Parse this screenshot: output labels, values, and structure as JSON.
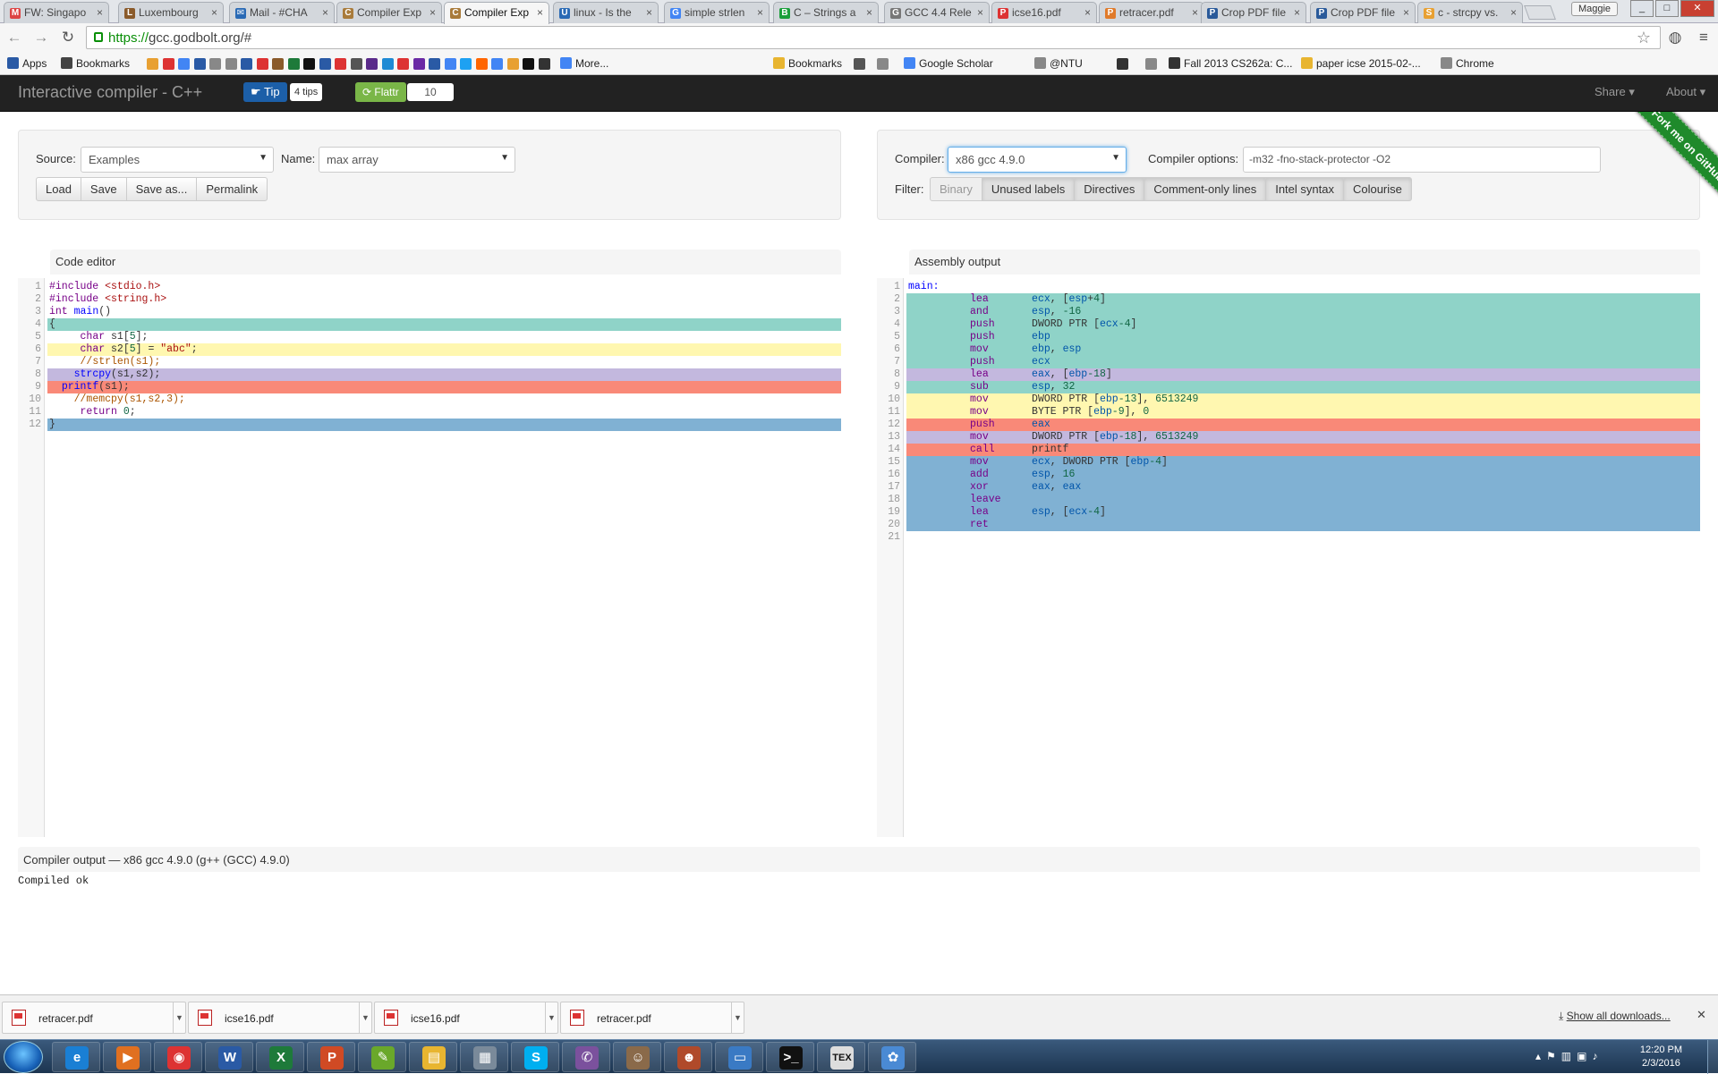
{
  "browser": {
    "tabs": [
      {
        "title": "FW: Singapo",
        "fav": "M",
        "color": "#d44"
      },
      {
        "title": "Luxembourg",
        "fav": "L",
        "color": "#8a5a2a"
      },
      {
        "title": "Mail - #CHA",
        "fav": "✉",
        "color": "#2a6ab5"
      },
      {
        "title": "Compiler Exp",
        "fav": "C",
        "color": "#a97b3a"
      },
      {
        "title": "Compiler Exp",
        "fav": "C",
        "color": "#a97b3a"
      },
      {
        "title": "linux - Is the",
        "fav": "U",
        "color": "#2a6ab5"
      },
      {
        "title": "simple strlen",
        "fav": "G",
        "color": "#4285f4"
      },
      {
        "title": "C – Strings a",
        "fav": "B",
        "color": "#1a9f3a"
      },
      {
        "title": "GCC 4.4 Rele",
        "fav": "G",
        "color": "#777"
      },
      {
        "title": "icse16.pdf",
        "fav": "P",
        "color": "#d33"
      },
      {
        "title": "retracer.pdf",
        "fav": "P",
        "color": "#e07a2a"
      },
      {
        "title": "Crop PDF file",
        "fav": "P",
        "color": "#2a5a9a"
      },
      {
        "title": "Crop PDF file",
        "fav": "P",
        "color": "#2a5a9a"
      },
      {
        "title": "c - strcpy vs.",
        "fav": "S",
        "color": "#e8a032"
      }
    ],
    "user": "Maggie",
    "window_buttons": [
      "_",
      "□",
      "✕"
    ],
    "url_scheme": "https://",
    "url_rest": "gcc.godbolt.org/#",
    "bookmarks": [
      {
        "label": "Apps",
        "icon": "#2a5aa5"
      },
      {
        "label": "Bookmarks",
        "icon": "#444"
      },
      {
        "label": "More...",
        "icon": "#4285f4"
      },
      {
        "label": "Bookmarks",
        "icon": "#e8b530"
      },
      {
        "label": "Google Scholar",
        "icon": "#4285f4"
      },
      {
        "label": "@NTU",
        "icon": "#888"
      },
      {
        "label": "Fall 2013 CS262a: C...",
        "icon": "#333"
      },
      {
        "label": "paper icse 2015-02-...",
        "icon": "#e8b530"
      },
      {
        "label": "Chrome",
        "icon": "#888"
      }
    ]
  },
  "navbar": {
    "brand": "Interactive compiler - C++",
    "tip_label": "Tip",
    "tip_count": "4 tips",
    "flattr_label": "Flattr",
    "flattr_count": "10",
    "share_label": "Share",
    "about_label": "About",
    "ribbon": "Fork me on GitHub"
  },
  "source": {
    "source_label": "Source:",
    "source_value": "Examples",
    "name_label": "Name:",
    "name_value": "max array",
    "buttons": [
      "Load",
      "Save",
      "Save as...",
      "Permalink"
    ]
  },
  "compiler": {
    "compiler_label": "Compiler:",
    "compiler_value": "x86 gcc 4.9.0",
    "options_label": "Compiler options:",
    "options_value": "-m32  -fno-stack-protector -O2",
    "filter_label": "Filter:",
    "filters": [
      "Binary",
      "Unused labels",
      "Directives",
      "Comment-only lines",
      "Intel syntax",
      "Colourise"
    ]
  },
  "editor": {
    "title": "Code editor",
    "lines": [
      {
        "n": "1",
        "text": "#include <stdio.h>",
        "bg": ""
      },
      {
        "n": "2",
        "text": "#include <string.h>",
        "bg": ""
      },
      {
        "n": "3",
        "text": "int main()",
        "bg": ""
      },
      {
        "n": "4",
        "text": "{",
        "bg": "#8fd3c8"
      },
      {
        "n": "5",
        "text": "     char s1[5];",
        "bg": ""
      },
      {
        "n": "6",
        "text": "     char s2[5] = \"abc\";",
        "bg": "#fff7b0"
      },
      {
        "n": "7",
        "text": "     //strlen(s1);",
        "bg": ""
      },
      {
        "n": "8",
        "text": "    strcpy(s1,s2);",
        "bg": "#c3b8de"
      },
      {
        "n": "9",
        "text": "  printf(s1);",
        "bg": "#f98978"
      },
      {
        "n": "10",
        "text": "    //memcpy(s1,s2,3);",
        "bg": ""
      },
      {
        "n": "11",
        "text": "     return 0;",
        "bg": ""
      },
      {
        "n": "12",
        "text": "}",
        "bg": "#80b1d3"
      }
    ]
  },
  "assembly": {
    "title": "Assembly output",
    "lines": [
      {
        "n": "1",
        "op": "",
        "args": "main:",
        "bg": ""
      },
      {
        "n": "2",
        "op": "lea",
        "args": "ecx, [esp+4]",
        "bg": "#8fd3c8"
      },
      {
        "n": "3",
        "op": "and",
        "args": "esp, -16",
        "bg": "#8fd3c8"
      },
      {
        "n": "4",
        "op": "push",
        "args": "DWORD PTR [ecx-4]",
        "bg": "#8fd3c8"
      },
      {
        "n": "5",
        "op": "push",
        "args": "ebp",
        "bg": "#8fd3c8"
      },
      {
        "n": "6",
        "op": "mov",
        "args": "ebp, esp",
        "bg": "#8fd3c8"
      },
      {
        "n": "7",
        "op": "push",
        "args": "ecx",
        "bg": "#8fd3c8"
      },
      {
        "n": "8",
        "op": "lea",
        "args": "eax, [ebp-18]",
        "bg": "#c3b8de"
      },
      {
        "n": "9",
        "op": "sub",
        "args": "esp, 32",
        "bg": "#8fd3c8"
      },
      {
        "n": "10",
        "op": "mov",
        "args": "DWORD PTR [ebp-13], 6513249",
        "bg": "#fff7b0"
      },
      {
        "n": "11",
        "op": "mov",
        "args": "BYTE PTR [ebp-9], 0",
        "bg": "#fff7b0"
      },
      {
        "n": "12",
        "op": "push",
        "args": "eax",
        "bg": "#f98978"
      },
      {
        "n": "13",
        "op": "mov",
        "args": "DWORD PTR [ebp-18], 6513249",
        "bg": "#c3b8de"
      },
      {
        "n": "14",
        "op": "call",
        "args": "printf",
        "bg": "#f98978"
      },
      {
        "n": "15",
        "op": "mov",
        "args": "ecx, DWORD PTR [ebp-4]",
        "bg": "#80b1d3"
      },
      {
        "n": "16",
        "op": "add",
        "args": "esp, 16",
        "bg": "#80b1d3"
      },
      {
        "n": "17",
        "op": "xor",
        "args": "eax, eax",
        "bg": "#80b1d3"
      },
      {
        "n": "18",
        "op": "leave",
        "args": "",
        "bg": "#80b1d3"
      },
      {
        "n": "19",
        "op": "lea",
        "args": "esp, [ecx-4]",
        "bg": "#80b1d3"
      },
      {
        "n": "20",
        "op": "ret",
        "args": "",
        "bg": "#80b1d3"
      },
      {
        "n": "21",
        "op": "",
        "args": "",
        "bg": ""
      }
    ]
  },
  "output": {
    "title": "Compiler output — x86 gcc 4.9.0 (g++ (GCC) 4.9.0)",
    "text": "Compiled ok"
  },
  "downloads": {
    "items": [
      "retracer.pdf",
      "icse16.pdf",
      "icse16.pdf",
      "retracer.pdf"
    ],
    "show_all": "Show all downloads..."
  },
  "taskbar": {
    "apps": [
      {
        "name": "ie",
        "glyph": "e",
        "color": "#1a7fd4"
      },
      {
        "name": "media",
        "glyph": "▶",
        "color": "#e07020"
      },
      {
        "name": "chrome",
        "glyph": "◉",
        "color": "#d33"
      },
      {
        "name": "word",
        "glyph": "W",
        "color": "#2a5aa5"
      },
      {
        "name": "excel",
        "glyph": "X",
        "color": "#1e7a3a"
      },
      {
        "name": "powerpoint",
        "glyph": "P",
        "color": "#d04a24"
      },
      {
        "name": "notepad",
        "glyph": "✎",
        "color": "#6aa82a"
      },
      {
        "name": "explorer",
        "glyph": "▤",
        "color": "#e8b530"
      },
      {
        "name": "calculator",
        "glyph": "▦",
        "color": "#7a8a9a"
      },
      {
        "name": "skype",
        "glyph": "S",
        "color": "#00aff0"
      },
      {
        "name": "viber",
        "glyph": "✆",
        "color": "#7b519d"
      },
      {
        "name": "app1",
        "glyph": "☺",
        "color": "#8a6a4a"
      },
      {
        "name": "app2",
        "glyph": "☻",
        "color": "#b04a2a"
      },
      {
        "name": "remote",
        "glyph": "▭",
        "color": "#3a7ac4"
      },
      {
        "name": "cmd",
        "glyph": ">_",
        "color": "#111"
      },
      {
        "name": "tex",
        "glyph": "TEX",
        "color": "#ddd"
      },
      {
        "name": "paint",
        "glyph": "✿",
        "color": "#4a8ad4"
      }
    ],
    "time": "12:20 PM",
    "date": "2/3/2016"
  }
}
